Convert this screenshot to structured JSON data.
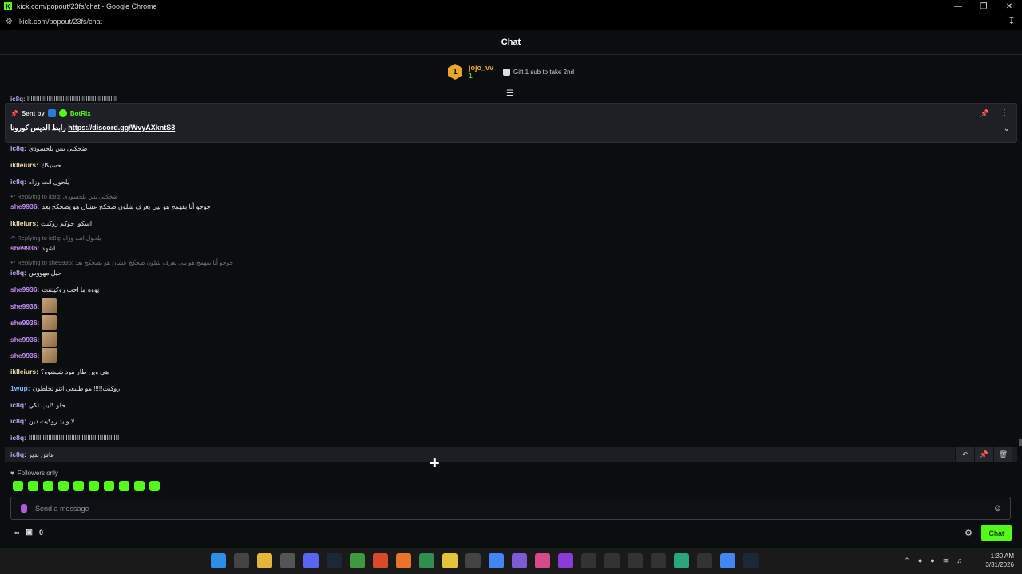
{
  "window": {
    "title": "kick.com/popout/23fs/chat - Google Chrome",
    "url": "kick.com/popout/23fs/chat"
  },
  "header": {
    "title": "Chat"
  },
  "leaderboard": {
    "rank": "1",
    "user": "jojo_vv",
    "count": "1",
    "gift_text": "Gift 1 sub to take 2nd"
  },
  "pinned": {
    "sent_by_label": "Sent by",
    "sender": "BotRix",
    "text_prefix": "رابط الديس كورونا",
    "link": "https://discord.gg/WvyAXkntS8"
  },
  "cut_message": {
    "user": "ic8q:",
    "text": "ااااااااااااااااااااااااااااااااااااااااااااااااااا"
  },
  "messages": [
    {
      "user": "ic8q:",
      "text": "ضحكني بس يلحسودي",
      "color": "#b9a7f0"
    },
    {
      "user": "iklleiurs:",
      "text": "حسبكك",
      "color": "#f0d9a7"
    },
    {
      "user": "ic8q:",
      "text": "يلحول انت وزاه",
      "color": "#b9a7f0"
    },
    {
      "user": "she9936:",
      "text": "جوجو أنا بفهمج هو بيي يعرف شلون ضحكج عشان هو يضحكج بعد",
      "color": "#c48af5"
    },
    {
      "user": "iklleiurs:",
      "text": "اسكوا جوكم روكيت",
      "color": "#f0d9a7"
    },
    {
      "user": "she9936:",
      "text": "اشهد",
      "color": "#c48af5"
    },
    {
      "user": "ic8q:",
      "text": "حيل مهووس",
      "color": "#b9a7f0"
    },
    {
      "user": "she9936:",
      "text": "يووه ما احب روكيتتتت",
      "color": "#c48af5"
    },
    {
      "user": "she9936:",
      "text": "",
      "color": "#c48af5"
    },
    {
      "user": "she9936:",
      "text": "",
      "color": "#c48af5"
    },
    {
      "user": "she9936:",
      "text": "",
      "color": "#c48af5"
    },
    {
      "user": "she9936:",
      "text": "",
      "color": "#c48af5"
    },
    {
      "user": "iklleiurs:",
      "text": "هي وين طار مود شيشوو؟",
      "color": "#f0d9a7"
    },
    {
      "user": "1wup:",
      "text": "روكيت!!!!! مو طبيعي انتو تجلطون",
      "color": "#7fb3ff"
    },
    {
      "user": "ic8q:",
      "text": "حلو كليب تكي",
      "color": "#b9a7f0"
    },
    {
      "user": "ic8q:",
      "text": "لا وايد روكيت دين",
      "color": "#b9a7f0"
    },
    {
      "user": "ic8q:",
      "text": "ااااااااااااااااااااااااااااااااااااااااااااااااااا",
      "color": "#b9a7f0"
    },
    {
      "user": "ic8q:",
      "text": "عاش بدير",
      "color": "#b9a7f0"
    }
  ],
  "replies": [
    {
      "text": "Replying to ic8q: ضحكني بس يلحسودي"
    },
    {
      "text": "Replying to ic8q: يلحول انت وزاه"
    },
    {
      "text": "Replying to she9936: جوجو أنا بفهمج هو بيي يعرف شلون ضحكج عشان هو يضحكج بعد"
    }
  ],
  "followers_only": "Followers only",
  "input": {
    "placeholder": "Send a message"
  },
  "bottom": {
    "points": "0",
    "chat_button": "Chat"
  },
  "clock": {
    "time": "1:30 AM",
    "date": "3/31/2026"
  }
}
